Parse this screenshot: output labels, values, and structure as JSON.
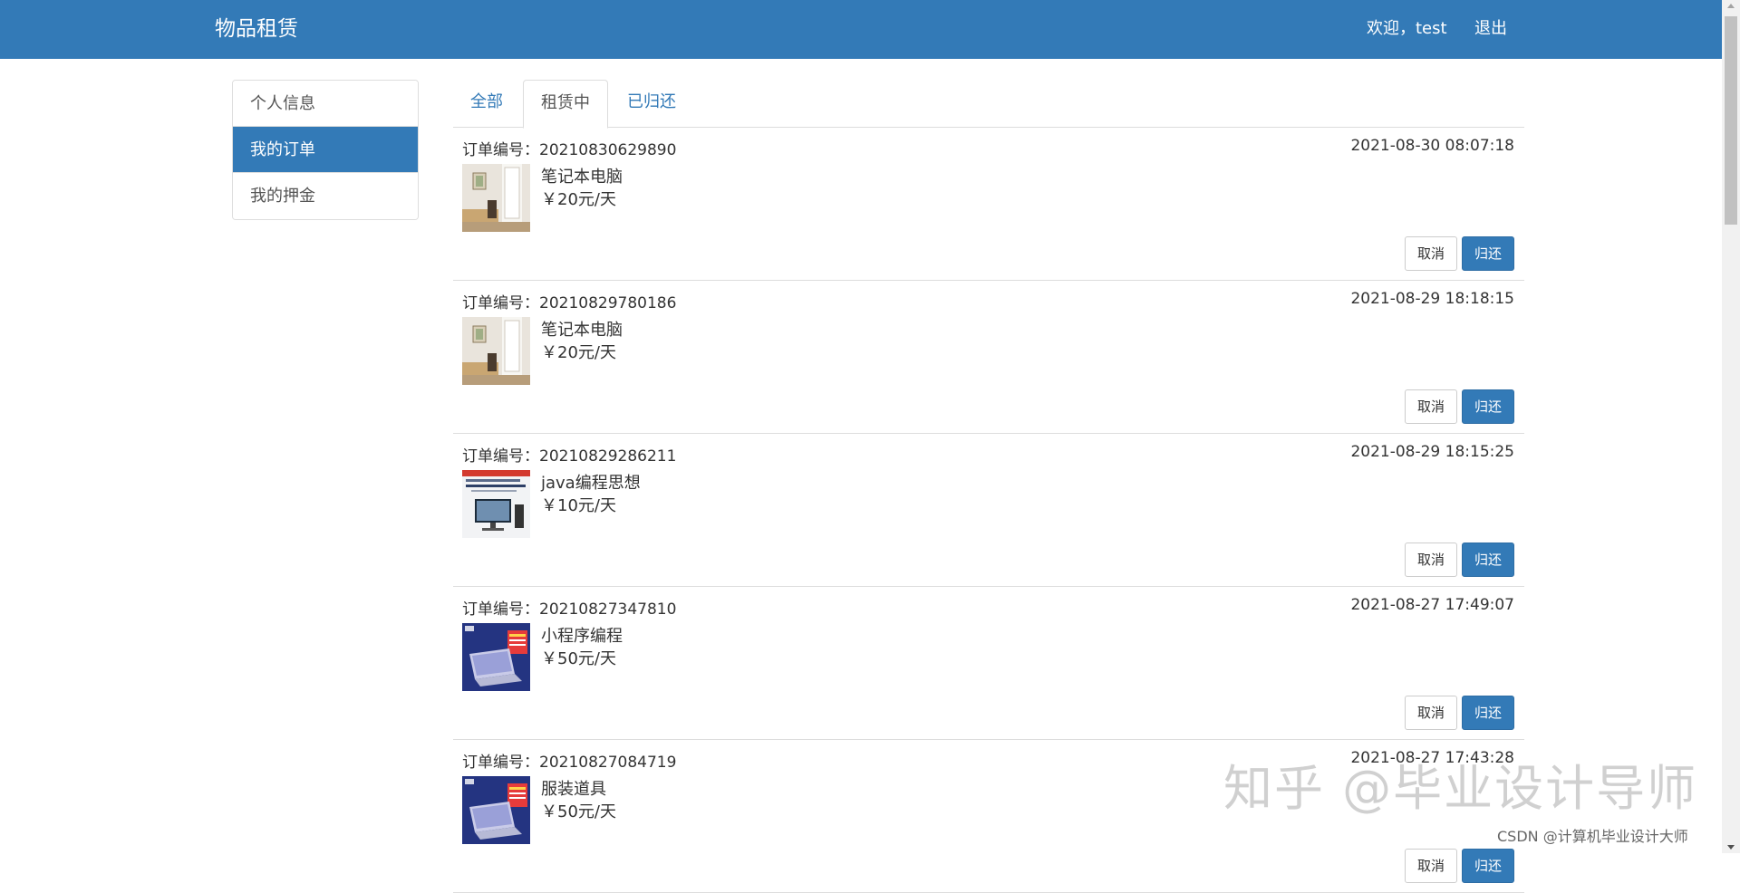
{
  "header": {
    "brand": "物品租赁",
    "user_greeting": "欢迎，test",
    "logout": "退出"
  },
  "sidebar": {
    "items": [
      {
        "label": "个人信息",
        "active": false
      },
      {
        "label": "我的订单",
        "active": true
      },
      {
        "label": "我的押金",
        "active": false
      }
    ]
  },
  "tabs": [
    {
      "label": "全部",
      "active": false
    },
    {
      "label": "租赁中",
      "active": true
    },
    {
      "label": "已归还",
      "active": false
    }
  ],
  "orders": [
    {
      "no_label": "订单编号：",
      "no": "20210830629890",
      "time": "2021-08-30 08:07:18",
      "name": "笔记本电脑",
      "price": "￥20元/天",
      "thumb": "room-photo",
      "cancel": "取消",
      "return": "归还"
    },
    {
      "no_label": "订单编号：",
      "no": "20210829780186",
      "time": "2021-08-29 18:18:15",
      "name": "笔记本电脑",
      "price": "￥20元/天",
      "thumb": "room-photo",
      "cancel": "取消",
      "return": "归还"
    },
    {
      "no_label": "订单编号：",
      "no": "20210829286211",
      "time": "2021-08-29 18:15:25",
      "name": "java编程思想",
      "price": "￥10元/天",
      "thumb": "desktop-ad",
      "cancel": "取消",
      "return": "归还"
    },
    {
      "no_label": "订单编号：",
      "no": "20210827347810",
      "time": "2021-08-27 17:49:07",
      "name": "小程序编程",
      "price": "￥50元/天",
      "thumb": "laptop-ad",
      "cancel": "取消",
      "return": "归还"
    },
    {
      "no_label": "订单编号：",
      "no": "20210827084719",
      "time": "2021-08-27 17:43:28",
      "name": "服装道具",
      "price": "￥50元/天",
      "thumb": "laptop-ad",
      "cancel": "取消",
      "return": "归还"
    }
  ],
  "watermark": "知乎 @毕业设计导师",
  "csdn_mark": "CSDN @计算机毕业设计大师",
  "colors": {
    "primary": "#337ab7",
    "border": "#dddddd"
  }
}
